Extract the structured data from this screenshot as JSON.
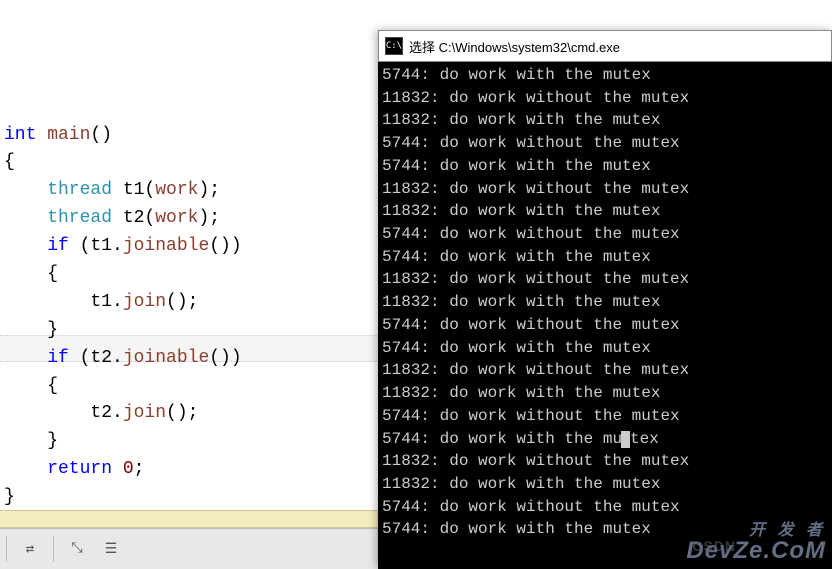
{
  "code": {
    "line1_kw": "int",
    "line1_func": " main",
    "line1_paren": "()",
    "line2": "{",
    "line3_cls": "    thread",
    "line3_plain": " t1(",
    "line3_arg": "work",
    "line3_end": ");",
    "line4_cls": "    thread",
    "line4_plain": " t2(",
    "line4_arg": "work",
    "line4_end": ");",
    "line5_kw": "    if",
    "line5_plain": " (t1.",
    "line5_func": "joinable",
    "line5_end": "())",
    "line6": "    {",
    "line7_plain": "        t1.",
    "line7_func": "join",
    "line7_end": "();",
    "line8": "    }",
    "line9_kw": "    if",
    "line9_plain": " (t2.",
    "line9_func": "joinable",
    "line9_end": "())",
    "line10": "    {",
    "line11_plain": "        t2.",
    "line11_func": "join",
    "line11_end": "();",
    "line12": "    }",
    "line13_kw": "    return",
    "line13_num": " 0",
    "line13_end": ";",
    "line14": "}"
  },
  "cmd": {
    "icon_label": "C:\\",
    "title": "选择 C:\\Windows\\system32\\cmd.exe",
    "lines": [
      "5744: do work with the mutex",
      "11832: do work without the mutex",
      "11832: do work with the mutex",
      "5744: do work without the mutex",
      "5744: do work with the mutex",
      "11832: do work without the mutex",
      "11832: do work with the mutex",
      "5744: do work without the mutex",
      "5744: do work with the mutex",
      "11832: do work without the mutex",
      "11832: do work with the mutex",
      "5744: do work without the mutex",
      "5744: do work with the mutex",
      "11832: do work without the mutex",
      "11832: do work with the mutex",
      "5744: do work without the mutex",
      "5744: do work with the mutex",
      "11832: do work without the mutex",
      "11832: do work with the mutex",
      "5744: do work without the mutex",
      "5744: do work with the mutex"
    ],
    "cursor_line_index": 16
  },
  "watermark": {
    "top": "开 发 者",
    "main": "DevZe.CoM",
    "csdn": "CSDN"
  },
  "toolbar": {
    "icons": [
      "⇄",
      "⤡",
      "☰"
    ]
  }
}
